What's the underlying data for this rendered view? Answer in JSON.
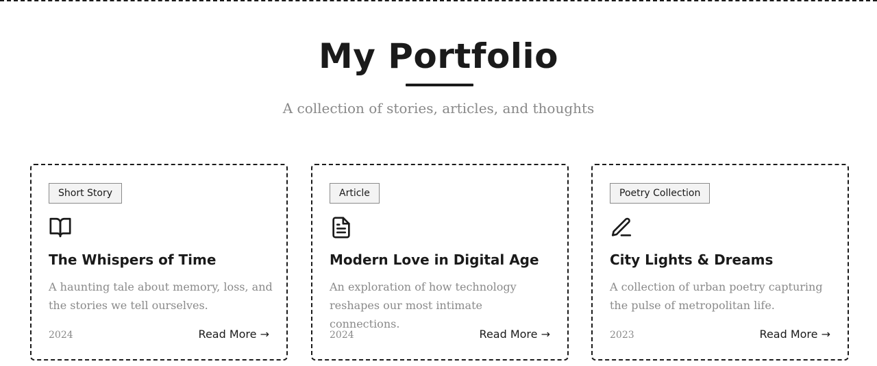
{
  "header": {
    "title": "My Portfolio",
    "subtitle": "A collection of stories, articles, and thoughts"
  },
  "cards": [
    {
      "tag": "Short Story",
      "icon": "book-open-icon",
      "title": "The Whispers of Time",
      "description": "A haunting tale about memory, loss, and the stories we tell ourselves.",
      "year": "2024",
      "link": "Read More →"
    },
    {
      "tag": "Article",
      "icon": "document-icon",
      "title": "Modern Love in Digital Age",
      "description": "An exploration of how technology reshapes our most intimate connections.",
      "year": "2024",
      "link": "Read More →"
    },
    {
      "tag": "Poetry Collection",
      "icon": "pen-icon",
      "title": "City Lights & Dreams",
      "description": "A collection of urban poetry capturing the pulse of metropolitan life.",
      "year": "2023",
      "link": "Read More →"
    }
  ],
  "colors": {
    "text": "#1a1a1a",
    "muted": "#888888",
    "tag_background": "#f3f3f3"
  }
}
